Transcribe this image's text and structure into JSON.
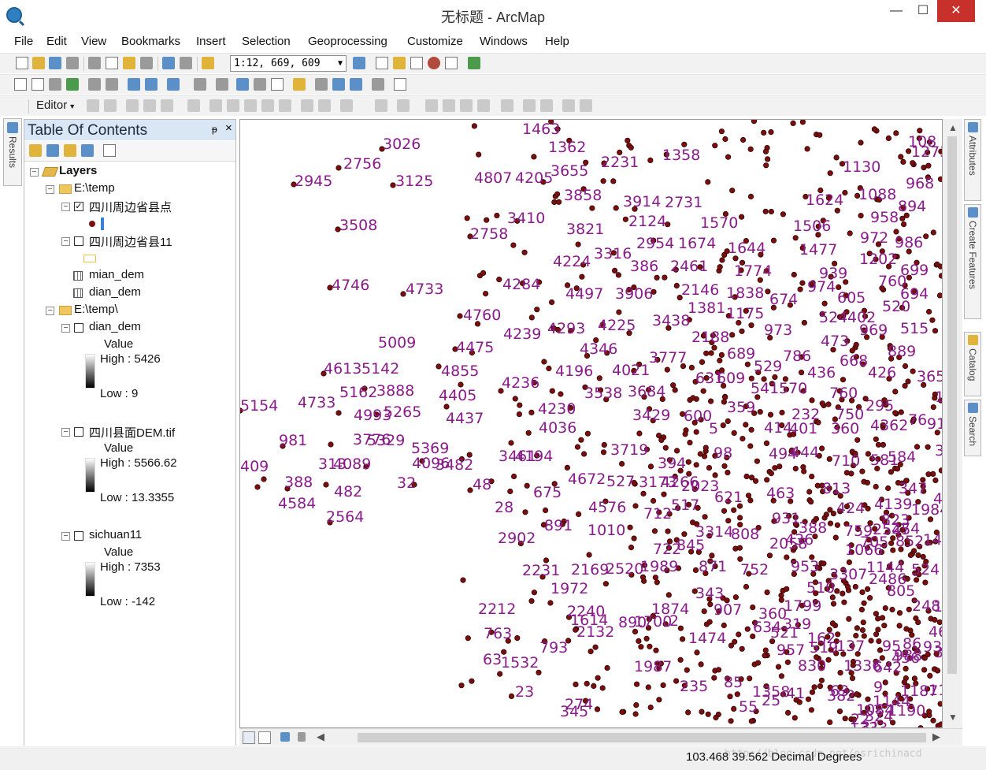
{
  "window": {
    "title": "无标题 - ArcMap",
    "minimize_glyph": "—",
    "maximize_glyph": "☐",
    "close_glyph": "✕"
  },
  "menus": [
    "File",
    "Edit",
    "View",
    "Bookmarks",
    "Insert",
    "Selection",
    "Geoprocessing",
    "Customize",
    "Windows",
    "Help"
  ],
  "toolbar": {
    "scale": "1:12, 669, 609",
    "editor_label": "Editor"
  },
  "side_tabs": {
    "left": "Results",
    "right": [
      "Attributes",
      "Create Features",
      "Catalog",
      "Search"
    ]
  },
  "toc": {
    "title": "Table Of Contents",
    "pin_glyph": "ᵽ",
    "close_glyph": "×",
    "root": "Layers",
    "group1": {
      "path": "E:\\temp",
      "layer_points": "四川周边省县点",
      "layer_poly": "四川周边省县11",
      "raster1": "mian_dem",
      "raster2": "dian_dem"
    },
    "group2": {
      "path": "E:\\temp\\",
      "layers": [
        {
          "name": "dian_dem",
          "value_label": "Value",
          "high": "High : 5426",
          "low": "Low : 9"
        },
        {
          "name": "四川县面DEM.tif",
          "value_label": "Value",
          "high": "High : 5566.62",
          "low": "Low : 13.3355"
        },
        {
          "name": "sichuan11",
          "value_label": "Value",
          "high": "High : 7353",
          "low": "Low : -142"
        }
      ]
    }
  },
  "map": {
    "point_color": "#7d0e0e",
    "label_color": "#8a1b8a",
    "labels": [
      {
        "t": "1463"
      },
      {
        "t": "1362"
      },
      {
        "t": "2231"
      },
      {
        "t": "1358"
      },
      {
        "t": "108"
      },
      {
        "t": "1273"
      },
      {
        "t": "3026"
      },
      {
        "t": "2756"
      },
      {
        "t": "2945"
      },
      {
        "t": "3125"
      },
      {
        "t": "4807"
      },
      {
        "t": "4205"
      },
      {
        "t": "3655"
      },
      {
        "t": "1130"
      },
      {
        "t": "968"
      },
      {
        "t": "1088"
      },
      {
        "t": "894"
      },
      {
        "t": "3858"
      },
      {
        "t": "3914"
      },
      {
        "t": "2731"
      },
      {
        "t": "1624"
      },
      {
        "t": "958"
      },
      {
        "t": "3508"
      },
      {
        "t": "3410"
      },
      {
        "t": "2758"
      },
      {
        "t": "3821"
      },
      {
        "t": "2124"
      },
      {
        "t": "1570"
      },
      {
        "t": "1506"
      },
      {
        "t": "972"
      },
      {
        "t": "986"
      },
      {
        "t": "2954"
      },
      {
        "t": "1674"
      },
      {
        "t": "3316"
      },
      {
        "t": "1644"
      },
      {
        "t": "1477"
      },
      {
        "t": "4224"
      },
      {
        "t": "386"
      },
      {
        "t": "2461"
      },
      {
        "t": "1202"
      },
      {
        "t": "699"
      },
      {
        "t": "4746"
      },
      {
        "t": "4733"
      },
      {
        "t": "4284"
      },
      {
        "t": "1774"
      },
      {
        "t": "939"
      },
      {
        "t": "760"
      },
      {
        "t": "4497"
      },
      {
        "t": "3906"
      },
      {
        "t": "2146"
      },
      {
        "t": "1838"
      },
      {
        "t": "694"
      },
      {
        "t": "974"
      },
      {
        "t": "605"
      },
      {
        "t": "674"
      },
      {
        "t": "520"
      },
      {
        "t": "4760"
      },
      {
        "t": "1381"
      },
      {
        "t": "1175"
      },
      {
        "t": "524"
      },
      {
        "t": "402"
      },
      {
        "t": "4225"
      },
      {
        "t": "3438"
      },
      {
        "t": "4293"
      },
      {
        "t": "4239"
      },
      {
        "t": "973"
      },
      {
        "t": "969"
      },
      {
        "t": "515"
      },
      {
        "t": "2188"
      },
      {
        "t": "473"
      },
      {
        "t": "5009"
      },
      {
        "t": "4475"
      },
      {
        "t": "4346"
      },
      {
        "t": "689"
      },
      {
        "t": "786"
      },
      {
        "t": "668"
      },
      {
        "t": "889"
      },
      {
        "t": "3777"
      },
      {
        "t": "4855"
      },
      {
        "t": "4613"
      },
      {
        "t": "5142"
      },
      {
        "t": "4196"
      },
      {
        "t": "4021"
      },
      {
        "t": "529"
      },
      {
        "t": "436"
      },
      {
        "t": "426"
      },
      {
        "t": "365"
      },
      {
        "t": "96"
      },
      {
        "t": "631"
      },
      {
        "t": "609"
      },
      {
        "t": "4236"
      },
      {
        "t": "5162"
      },
      {
        "t": "3888"
      },
      {
        "t": "4405"
      },
      {
        "t": "3538"
      },
      {
        "t": "3684"
      },
      {
        "t": "541"
      },
      {
        "t": "570"
      },
      {
        "t": "760"
      },
      {
        "t": "121"
      },
      {
        "t": "5154"
      },
      {
        "t": "4733"
      },
      {
        "t": "4230"
      },
      {
        "t": "295"
      },
      {
        "t": "359"
      },
      {
        "t": "4993"
      },
      {
        "t": "5265"
      },
      {
        "t": "4437"
      },
      {
        "t": "3429"
      },
      {
        "t": "600"
      },
      {
        "t": "232"
      },
      {
        "t": "750"
      },
      {
        "t": "76"
      },
      {
        "t": "4036"
      },
      {
        "t": "4362"
      },
      {
        "t": "913"
      },
      {
        "t": "5"
      },
      {
        "t": "414"
      },
      {
        "t": "401"
      },
      {
        "t": "360"
      },
      {
        "t": "981"
      },
      {
        "t": "5369"
      },
      {
        "t": "5329"
      },
      {
        "t": "3776"
      },
      {
        "t": "3719"
      },
      {
        "t": "3944"
      },
      {
        "t": "98"
      },
      {
        "t": "444"
      },
      {
        "t": "494"
      },
      {
        "t": "313"
      },
      {
        "t": "4089"
      },
      {
        "t": "4096"
      },
      {
        "t": "3482"
      },
      {
        "t": "3461"
      },
      {
        "t": "4194"
      },
      {
        "t": "584"
      },
      {
        "t": "394"
      },
      {
        "t": "710"
      },
      {
        "t": "581"
      },
      {
        "t": "409"
      },
      {
        "t": "388"
      },
      {
        "t": "32"
      },
      {
        "t": "48"
      },
      {
        "t": "4672"
      },
      {
        "t": "527"
      },
      {
        "t": "3173"
      },
      {
        "t": "4266"
      },
      {
        "t": "2023"
      },
      {
        "t": "813"
      },
      {
        "t": "347"
      },
      {
        "t": "482"
      },
      {
        "t": "675"
      },
      {
        "t": "463"
      },
      {
        "t": "4152"
      },
      {
        "t": "4584"
      },
      {
        "t": "621"
      },
      {
        "t": "28"
      },
      {
        "t": "4576"
      },
      {
        "t": "517"
      },
      {
        "t": "4139"
      },
      {
        "t": "2564"
      },
      {
        "t": "712"
      },
      {
        "t": "931"
      },
      {
        "t": "424"
      },
      {
        "t": "1984"
      },
      {
        "t": "823"
      },
      {
        "t": "891"
      },
      {
        "t": "388"
      },
      {
        "t": "274"
      },
      {
        "t": "3314"
      },
      {
        "t": "808"
      },
      {
        "t": "1010"
      },
      {
        "t": "759"
      },
      {
        "t": "2545"
      },
      {
        "t": "1407"
      },
      {
        "t": "2902"
      },
      {
        "t": "722"
      },
      {
        "t": "436"
      },
      {
        "t": "705"
      },
      {
        "t": "852"
      },
      {
        "t": "2058"
      },
      {
        "t": "845"
      },
      {
        "t": "1066"
      },
      {
        "t": "2231"
      },
      {
        "t": "2169"
      },
      {
        "t": "2520"
      },
      {
        "t": "1989"
      },
      {
        "t": "871"
      },
      {
        "t": "953"
      },
      {
        "t": "1144"
      },
      {
        "t": "524"
      },
      {
        "t": "752"
      },
      {
        "t": "3307"
      },
      {
        "t": "2486"
      },
      {
        "t": "1972"
      },
      {
        "t": "343"
      },
      {
        "t": "510"
      },
      {
        "t": "1799"
      },
      {
        "t": "805"
      },
      {
        "t": "2212"
      },
      {
        "t": "2240"
      },
      {
        "t": "1874"
      },
      {
        "t": "907"
      },
      {
        "t": "360"
      },
      {
        "t": "248"
      },
      {
        "t": "890"
      },
      {
        "t": "1614"
      },
      {
        "t": "1700"
      },
      {
        "t": "2"
      },
      {
        "t": "634"
      },
      {
        "t": "319"
      },
      {
        "t": "145"
      },
      {
        "t": "2132"
      },
      {
        "t": "763"
      },
      {
        "t": "46"
      },
      {
        "t": "1474"
      },
      {
        "t": "521"
      },
      {
        "t": "162"
      },
      {
        "t": "793"
      },
      {
        "t": "137"
      },
      {
        "t": "95"
      },
      {
        "t": "54"
      },
      {
        "t": "957"
      },
      {
        "t": "456"
      },
      {
        "t": "1532"
      },
      {
        "t": "93"
      },
      {
        "t": "38"
      },
      {
        "t": "988"
      },
      {
        "t": "63"
      },
      {
        "t": "519"
      },
      {
        "t": "1987"
      },
      {
        "t": "1336"
      },
      {
        "t": "642"
      },
      {
        "t": "23"
      },
      {
        "t": "345"
      },
      {
        "t": "85"
      },
      {
        "t": "830"
      },
      {
        "t": "86"
      },
      {
        "t": "1084"
      },
      {
        "t": "1144"
      },
      {
        "t": "1190"
      },
      {
        "t": "63"
      },
      {
        "t": "274"
      },
      {
        "t": "235"
      },
      {
        "t": "25"
      },
      {
        "t": "382"
      },
      {
        "t": "1154"
      },
      {
        "t": "55"
      },
      {
        "t": "1358"
      },
      {
        "t": "41"
      },
      {
        "t": "1187"
      },
      {
        "t": "9"
      },
      {
        "t": "324"
      },
      {
        "t": "22"
      },
      {
        "t": "31"
      },
      {
        "t": "1333"
      }
    ]
  },
  "status": {
    "coordinates": "103.468  39.562 Decimal Degrees",
    "watermark": "http://blog.csdn.net/esrichinacd"
  }
}
